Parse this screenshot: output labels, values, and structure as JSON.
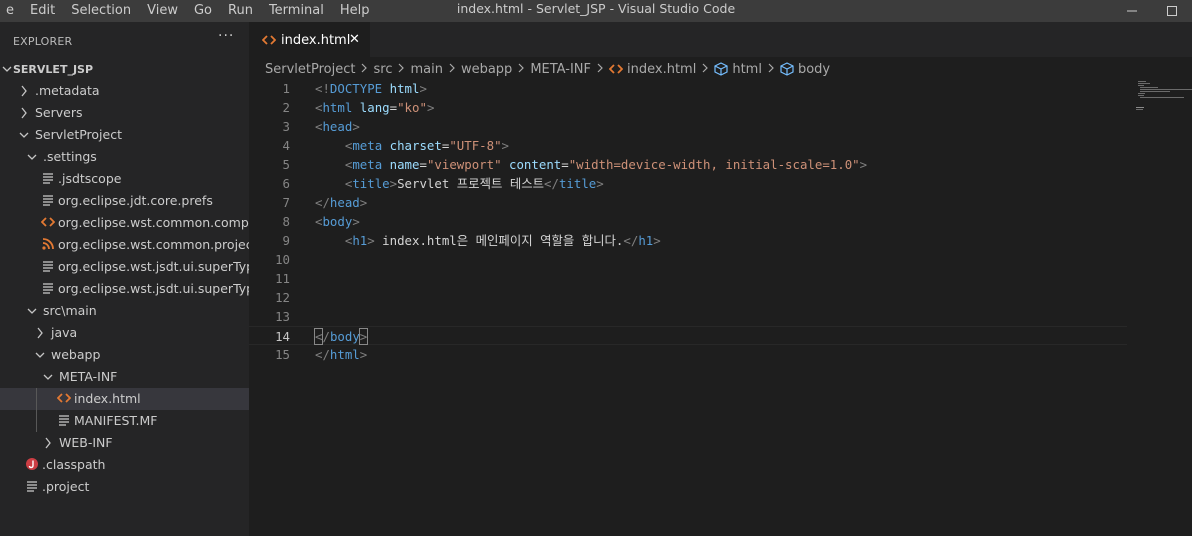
{
  "menu": [
    "e",
    "Edit",
    "Selection",
    "View",
    "Go",
    "Run",
    "Terminal",
    "Help"
  ],
  "window_title": "index.html - Servlet_JSP - Visual Studio Code",
  "explorer": {
    "title": "EXPLORER",
    "more": "···",
    "tree": [
      {
        "label": "SERVLET_JSP",
        "indent": 0,
        "chevron": "down",
        "icon": "none",
        "root": true
      },
      {
        "label": ".metadata",
        "indent": 1,
        "chevron": "right",
        "icon": "none"
      },
      {
        "label": "Servers",
        "indent": 1,
        "chevron": "right",
        "icon": "none"
      },
      {
        "label": "ServletProject",
        "indent": 1,
        "chevron": "down",
        "icon": "none"
      },
      {
        "label": ".settings",
        "indent": 2,
        "chevron": "down",
        "icon": "none"
      },
      {
        "label": ".jsdtscope",
        "indent": 3,
        "chevron": "none",
        "icon": "lines"
      },
      {
        "label": "org.eclipse.jdt.core.prefs",
        "indent": 3,
        "chevron": "none",
        "icon": "lines"
      },
      {
        "label": "org.eclipse.wst.common.compone...",
        "indent": 3,
        "chevron": "none",
        "icon": "code"
      },
      {
        "label": "org.eclipse.wst.common.project.fa...",
        "indent": 3,
        "chevron": "none",
        "icon": "rss"
      },
      {
        "label": "org.eclipse.wst.jsdt.ui.superType.c...",
        "indent": 3,
        "chevron": "none",
        "icon": "lines"
      },
      {
        "label": "org.eclipse.wst.jsdt.ui.superType.n...",
        "indent": 3,
        "chevron": "none",
        "icon": "lines"
      },
      {
        "label": "src\\main",
        "indent": 2,
        "chevron": "down",
        "icon": "none"
      },
      {
        "label": "java",
        "indent": 3,
        "chevron": "right",
        "icon": "none"
      },
      {
        "label": "webapp",
        "indent": 3,
        "chevron": "down",
        "icon": "none"
      },
      {
        "label": "META-INF",
        "indent": 4,
        "chevron": "down",
        "icon": "none"
      },
      {
        "label": "index.html",
        "indent": 5,
        "chevron": "none",
        "icon": "code",
        "selected": true
      },
      {
        "label": "MANIFEST.MF",
        "indent": 5,
        "chevron": "none",
        "icon": "lines"
      },
      {
        "label": "WEB-INF",
        "indent": 4,
        "chevron": "right",
        "icon": "none"
      },
      {
        "label": ".classpath",
        "indent": 1,
        "chevron": "none",
        "icon": "java"
      },
      {
        "label": ".project",
        "indent": 1,
        "chevron": "none",
        "icon": "lines"
      }
    ]
  },
  "tab": {
    "label": "index.html",
    "close": "✕"
  },
  "breadcrumb": [
    {
      "label": "ServletProject",
      "icon": "none"
    },
    {
      "label": "src",
      "icon": "none"
    },
    {
      "label": "main",
      "icon": "none"
    },
    {
      "label": "webapp",
      "icon": "none"
    },
    {
      "label": "META-INF",
      "icon": "none"
    },
    {
      "label": "index.html",
      "icon": "code"
    },
    {
      "label": "html",
      "icon": "cube"
    },
    {
      "label": "body",
      "icon": "cube"
    }
  ],
  "editor": {
    "current_line": 14,
    "lines": [
      {
        "n": "1",
        "tokens": [
          [
            "brk",
            "<!"
          ],
          [
            "tag",
            "DOCTYPE"
          ],
          [
            "txt",
            " "
          ],
          [
            "attr",
            "html"
          ],
          [
            "brk",
            ">"
          ]
        ]
      },
      {
        "n": "2",
        "tokens": [
          [
            "brk",
            "<"
          ],
          [
            "tag",
            "html"
          ],
          [
            "txt",
            " "
          ],
          [
            "attr",
            "lang"
          ],
          [
            "txt",
            "="
          ],
          [
            "str",
            "\"ko\""
          ],
          [
            "brk",
            ">"
          ]
        ]
      },
      {
        "n": "3",
        "tokens": [
          [
            "brk",
            "<"
          ],
          [
            "tag",
            "head"
          ],
          [
            "brk",
            ">"
          ]
        ]
      },
      {
        "n": "4",
        "tokens": [
          [
            "txt",
            "    "
          ],
          [
            "brk",
            "<"
          ],
          [
            "tag",
            "meta"
          ],
          [
            "txt",
            " "
          ],
          [
            "attr",
            "charset"
          ],
          [
            "txt",
            "="
          ],
          [
            "str",
            "\"UTF-8\""
          ],
          [
            "brk",
            ">"
          ]
        ]
      },
      {
        "n": "5",
        "tokens": [
          [
            "txt",
            "    "
          ],
          [
            "brk",
            "<"
          ],
          [
            "tag",
            "meta"
          ],
          [
            "txt",
            " "
          ],
          [
            "attr",
            "name"
          ],
          [
            "txt",
            "="
          ],
          [
            "str",
            "\"viewport\""
          ],
          [
            "txt",
            " "
          ],
          [
            "attr",
            "content"
          ],
          [
            "txt",
            "="
          ],
          [
            "str",
            "\"width=device-width, initial-scale=1.0\""
          ],
          [
            "brk",
            ">"
          ]
        ]
      },
      {
        "n": "6",
        "tokens": [
          [
            "txt",
            "    "
          ],
          [
            "brk",
            "<"
          ],
          [
            "tag",
            "title"
          ],
          [
            "brk",
            ">"
          ],
          [
            "txt",
            "Servlet 프로젝트 테스트"
          ],
          [
            "brk",
            "</"
          ],
          [
            "tag",
            "title"
          ],
          [
            "brk",
            ">"
          ]
        ]
      },
      {
        "n": "7",
        "tokens": [
          [
            "brk",
            "</"
          ],
          [
            "tag",
            "head"
          ],
          [
            "brk",
            ">"
          ]
        ]
      },
      {
        "n": "8",
        "tokens": [
          [
            "brk",
            "<"
          ],
          [
            "tag",
            "body"
          ],
          [
            "brk",
            ">"
          ]
        ]
      },
      {
        "n": "9",
        "tokens": [
          [
            "txt",
            "    "
          ],
          [
            "brk",
            "<"
          ],
          [
            "tag",
            "h1"
          ],
          [
            "brk",
            ">"
          ],
          [
            "txt",
            " index.html은 메인페이지 역할을 합니다."
          ],
          [
            "brk",
            "</"
          ],
          [
            "tag",
            "h1"
          ],
          [
            "brk",
            ">"
          ]
        ]
      },
      {
        "n": "10",
        "tokens": []
      },
      {
        "n": "11",
        "tokens": []
      },
      {
        "n": "12",
        "tokens": []
      },
      {
        "n": "13",
        "tokens": []
      },
      {
        "n": "14",
        "tokens": [
          [
            "brkm",
            "<"
          ],
          [
            "brk",
            "/"
          ],
          [
            "tag",
            "body"
          ],
          [
            "brkm",
            ">"
          ],
          [
            "cursor",
            ""
          ]
        ]
      },
      {
        "n": "15",
        "tokens": [
          [
            "brk",
            "</"
          ],
          [
            "tag",
            "html"
          ],
          [
            "brk",
            ">"
          ]
        ]
      }
    ]
  },
  "colors": {
    "accent_orange": "#e37933",
    "folder_text": "#cccccc",
    "java_red": "#cc3e44"
  }
}
